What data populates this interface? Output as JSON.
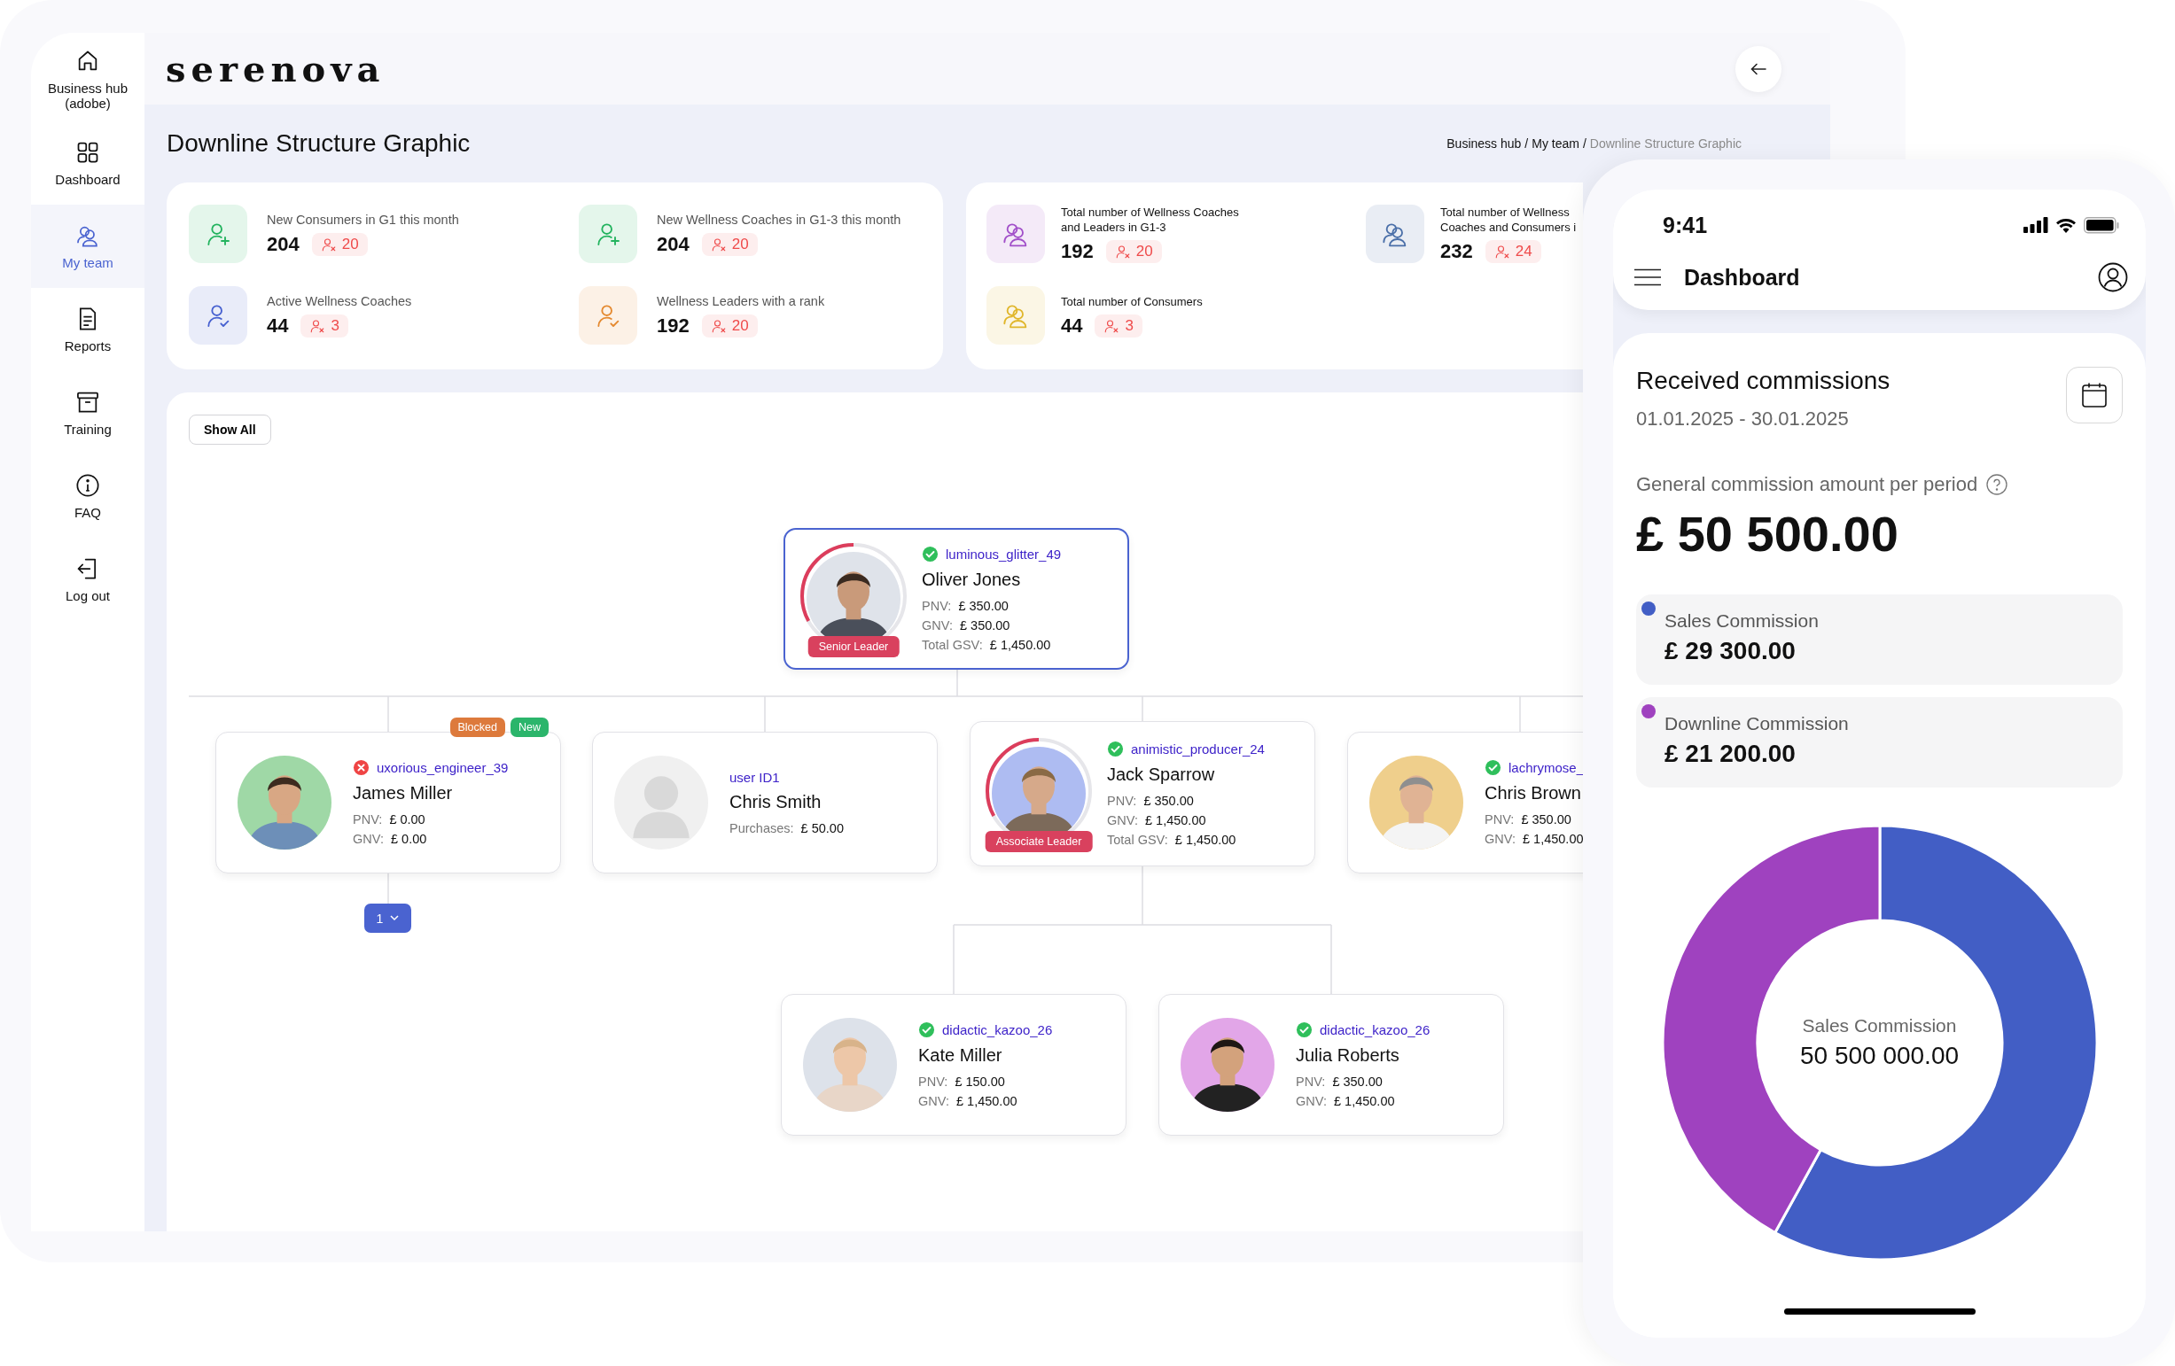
{
  "sidebar": {
    "items": [
      {
        "kind": "home",
        "label": "Business hub (adobe)",
        "selected": false
      },
      {
        "kind": "grid",
        "label": "Dashboard",
        "selected": false
      },
      {
        "kind": "team",
        "label": "My team",
        "selected": true
      },
      {
        "kind": "document",
        "label": "Reports",
        "selected": false
      },
      {
        "kind": "archive",
        "label": "Training",
        "selected": false
      },
      {
        "kind": "info",
        "label": "FAQ",
        "selected": false
      },
      {
        "kind": "logout",
        "label": "Log out",
        "selected": false
      }
    ]
  },
  "header": {
    "logo": "serenova"
  },
  "page": {
    "title": "Downline Structure Graphic",
    "separator": "/",
    "breadcrumb": [
      {
        "label": "Business hub",
        "current": false
      },
      {
        "label": "My team",
        "current": false
      },
      {
        "label": "Downline Structure Graphic",
        "current": true
      }
    ]
  },
  "stat_cards": [
    {
      "items": [
        {
          "kind": "user-plus",
          "color": "#22b35e",
          "label": "New Consumers in G1 this month",
          "value": "204",
          "change": "20"
        },
        {
          "kind": "user-plus",
          "color": "#22b35e",
          "label": "New Wellness Coaches in G1-3 this month",
          "value": "204",
          "change": "20"
        },
        {
          "kind": "user-check",
          "color": "#4660d0",
          "label": "Active Wellness Coaches",
          "value": "44",
          "change": "3"
        },
        {
          "kind": "user-check",
          "color": "#e4892f",
          "label": "Wellness Leaders with a rank",
          "value": "192",
          "change": "20"
        }
      ]
    },
    {
      "items": [
        {
          "kind": "users",
          "color": "#a14fc9",
          "label": "Total number of Wellness Coaches\nand Leaders in G1-3",
          "value": "192",
          "change": "20"
        },
        {
          "kind": "users",
          "color": "#4a6fa8",
          "label": "Total number of Wellness\nCoaches and Consumers i",
          "value": "232",
          "change": "24"
        },
        {
          "kind": "users",
          "color": "#e0b62a",
          "label": "Total number of Consumers",
          "value": "44",
          "change": "3"
        }
      ]
    }
  ],
  "tree": {
    "show_all": "Show All",
    "root": {
      "username": "luminous_glitter_49",
      "verified": true,
      "name": "Oliver Jones",
      "selected": true,
      "avatar": {
        "kind": "picture"
      },
      "rank": {
        "label": "Senior Leader"
      },
      "metrics": [
        {
          "label": "PNV:",
          "value": "£ 350.00"
        },
        {
          "label": "GNV:",
          "value": "£ 350.00"
        },
        {
          "label": "Total GSV:",
          "value": "£ 1,450.00"
        }
      ],
      "children": [
        {
          "username": "uxorious_engineer_39",
          "verified": false,
          "name": "James Miller",
          "selected": false,
          "avatar": {
            "kind": "picture"
          },
          "tags": [
            {
              "label": "Blocked",
              "color": "#dd7a3c"
            },
            {
              "label": "New",
              "color": "#2bb56b"
            }
          ],
          "pager": "1",
          "metrics": [
            {
              "label": "PNV:",
              "value": "£ 0.00"
            },
            {
              "label": "GNV:",
              "value": "£ 0.00"
            }
          ]
        },
        {
          "username": "user ID1",
          "name": "Chris Smith",
          "selected": false,
          "avatar": {
            "kind": "placeholder"
          },
          "metrics": [
            {
              "label": "Purchases:",
              "value": "£ 50.00"
            }
          ]
        },
        {
          "username": "animistic_producer_24",
          "verified": true,
          "name": "Jack Sparrow",
          "selected": false,
          "avatar": {
            "kind": "picture"
          },
          "rank": {
            "label": "Associate Leader"
          },
          "metrics": [
            {
              "label": "PNV:",
              "value": "£ 350.00"
            },
            {
              "label": "GNV:",
              "value": "£ 1,450.00"
            },
            {
              "label": "Total GSV:",
              "value": "£ 1,450.00"
            }
          ],
          "children": [
            {
              "username": "didactic_kazoo_26",
              "verified": true,
              "name": "Kate Miller",
              "selected": false,
              "avatar": {
                "kind": "picture"
              },
              "metrics": [
                {
                  "label": "PNV:",
                  "value": "£ 150.00"
                },
                {
                  "label": "GNV:",
                  "value": "£ 1,450.00"
                }
              ]
            },
            {
              "username": "didactic_kazoo_26",
              "verified": true,
              "name": "Julia Roberts",
              "selected": false,
              "avatar": {
                "kind": "picture"
              },
              "metrics": [
                {
                  "label": "PNV:",
                  "value": "£ 350.00"
                },
                {
                  "label": "GNV:",
                  "value": "£ 1,450.00"
                }
              ]
            }
          ]
        },
        {
          "username": "lachrymose_",
          "verified": true,
          "name": "Chris Brown",
          "selected": false,
          "avatar": {
            "kind": "picture"
          },
          "metrics": [
            {
              "label": "PNV:",
              "value": "£ 350.00"
            },
            {
              "label": "GNV:",
              "value": "£ 1,450.00"
            }
          ]
        }
      ]
    }
  },
  "phone": {
    "status_bar": {
      "time": "9:41"
    },
    "title": "Dashboard",
    "commissions": {
      "title": "Received commissions",
      "period": "01.01.2025 - 30.01.2025",
      "total_label": "General commission amount per period",
      "total": "£ 50 500.00",
      "items": [
        {
          "amount": "£ 29 300.00",
          "color": "#425ec5"
        },
        {
          "amount": "£ 21 200.00",
          "color": "#9f42bf"
        }
      ],
      "chart_data": {
        "type": "donut",
        "categories": [
          "Sales Commission",
          "Downline Commission"
        ],
        "values": [
          58.02,
          41.98
        ]
      },
      "center_label": "Sales Commission",
      "center_value": "50 500 000.00"
    }
  }
}
